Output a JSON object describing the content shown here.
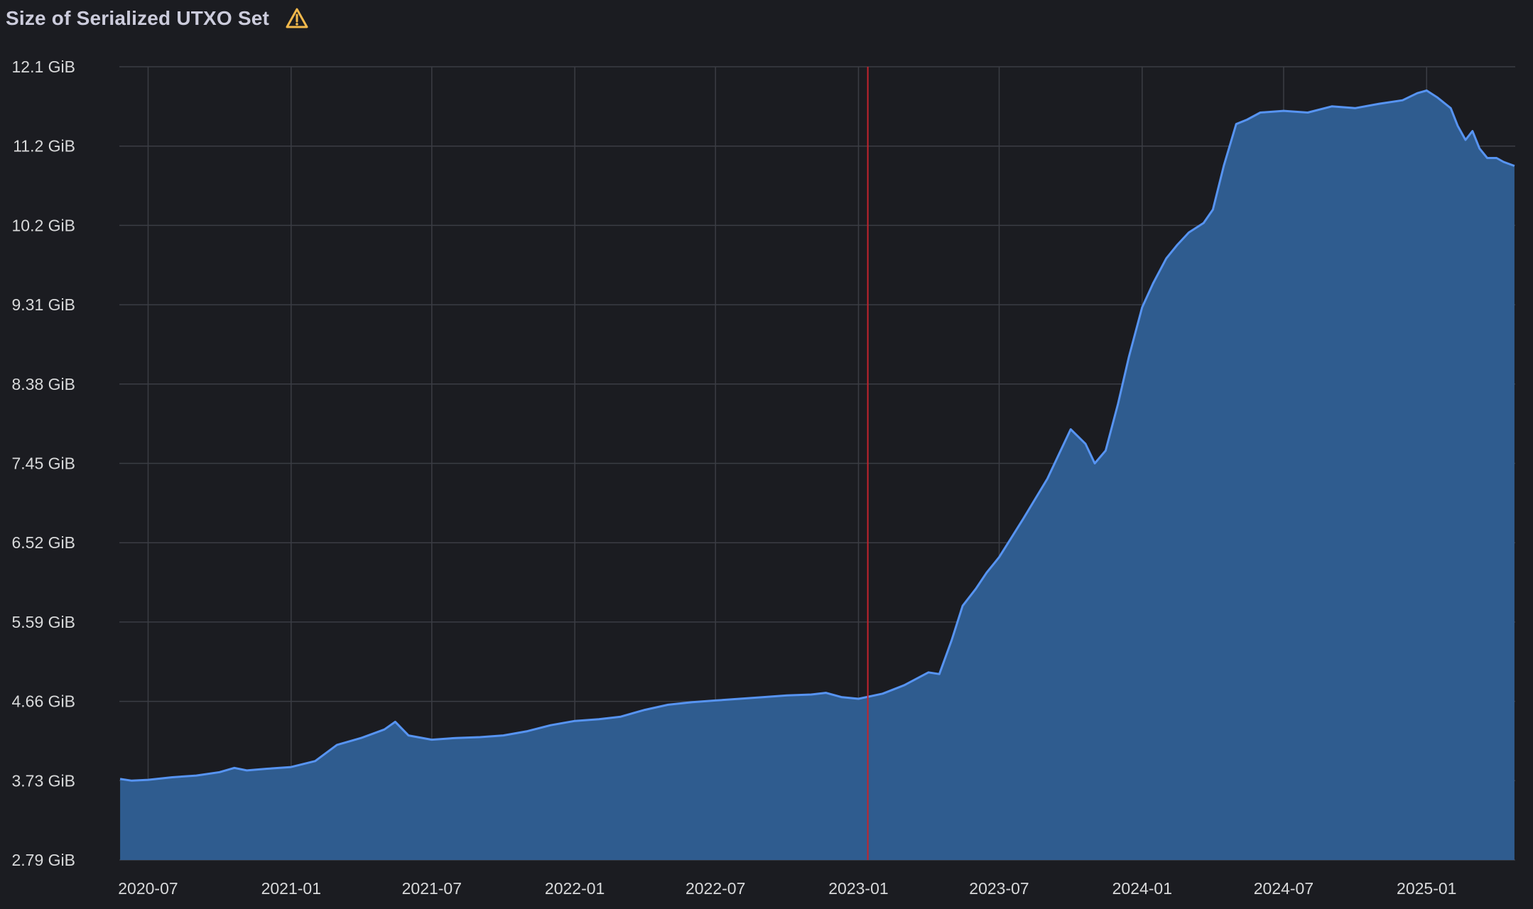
{
  "panel": {
    "title": "Size of Serialized UTXO Set",
    "warning_icon": "warning-triangle-icon"
  },
  "colors": {
    "background": "#1b1c21",
    "grid": "#3b3d44",
    "series_line": "#5794f2",
    "series_fill": "#2f5c8f",
    "annotation_line": "#c4242d",
    "warning": "#f2b84b"
  },
  "chart_data": {
    "type": "area",
    "title": "Size of Serialized UTXO Set",
    "xlabel": "",
    "ylabel": "",
    "y_unit": "GiB",
    "ylim": [
      2.79,
      12.1
    ],
    "xlim": [
      "2020-05-25",
      "2025-04-25"
    ],
    "grid": true,
    "y_ticks": [
      2.79,
      3.73,
      4.66,
      5.59,
      6.52,
      7.45,
      8.38,
      9.31,
      10.2,
      11.2,
      12.1
    ],
    "y_tick_labels": [
      "2.79 GiB",
      "3.73 GiB",
      "4.66 GiB",
      "5.59 GiB",
      "6.52 GiB",
      "7.45 GiB",
      "8.38 GiB",
      "9.31 GiB",
      "10.2 GiB",
      "11.2 GiB",
      "12.1 GiB"
    ],
    "x_ticks": [
      "2020-07-01",
      "2021-01-01",
      "2021-07-01",
      "2022-01-01",
      "2022-07-01",
      "2023-01-01",
      "2023-07-01",
      "2024-01-01",
      "2024-07-01",
      "2025-01-01"
    ],
    "x_tick_labels": [
      "2020-07",
      "2021-01",
      "2021-07",
      "2022-01",
      "2022-07",
      "2023-01",
      "2023-07",
      "2024-01",
      "2024-07",
      "2025-01"
    ],
    "annotations": [
      {
        "type": "vertical-line",
        "x": "2023-01-13"
      }
    ],
    "series": [
      {
        "x": [
          "2020-05-26",
          "2020-06-10",
          "2020-07-01",
          "2020-08-01",
          "2020-09-01",
          "2020-10-01",
          "2020-10-20",
          "2020-11-05",
          "2020-12-01",
          "2021-01-01",
          "2021-02-01",
          "2021-03-01",
          "2021-04-01",
          "2021-05-01",
          "2021-05-15",
          "2021-06-01",
          "2021-07-01",
          "2021-08-01",
          "2021-09-01",
          "2021-10-01",
          "2021-11-01",
          "2021-12-01",
          "2022-01-01",
          "2022-02-01",
          "2022-03-01",
          "2022-04-01",
          "2022-05-01",
          "2022-06-01",
          "2022-07-01",
          "2022-08-01",
          "2022-09-01",
          "2022-10-01",
          "2022-11-01",
          "2022-11-20",
          "2022-12-10",
          "2023-01-01",
          "2023-02-01",
          "2023-03-01",
          "2023-04-01",
          "2023-04-15",
          "2023-05-01",
          "2023-05-15",
          "2023-06-01",
          "2023-06-15",
          "2023-07-01",
          "2023-08-01",
          "2023-09-01",
          "2023-10-01",
          "2023-10-20",
          "2023-11-01",
          "2023-11-15",
          "2023-12-01",
          "2023-12-15",
          "2024-01-01",
          "2024-01-15",
          "2024-02-01",
          "2024-02-15",
          "2024-03-01",
          "2024-03-20",
          "2024-04-01",
          "2024-04-15",
          "2024-05-01",
          "2024-05-15",
          "2024-06-01",
          "2024-07-01",
          "2024-08-01",
          "2024-09-01",
          "2024-10-01",
          "2024-11-01",
          "2024-12-01",
          "2024-12-20",
          "2025-01-01",
          "2025-01-15",
          "2025-02-01",
          "2025-02-10",
          "2025-02-20",
          "2025-03-01",
          "2025-03-10",
          "2025-03-20",
          "2025-04-01",
          "2025-04-10",
          "2025-04-24"
        ],
        "values": [
          3.75,
          3.73,
          3.74,
          3.77,
          3.79,
          3.83,
          3.88,
          3.85,
          3.87,
          3.89,
          3.96,
          4.15,
          4.23,
          4.33,
          4.42,
          4.26,
          4.21,
          4.23,
          4.24,
          4.26,
          4.31,
          4.38,
          4.43,
          4.45,
          4.48,
          4.56,
          4.62,
          4.65,
          4.67,
          4.69,
          4.71,
          4.73,
          4.74,
          4.76,
          4.71,
          4.69,
          4.75,
          4.85,
          5.0,
          4.98,
          5.38,
          5.78,
          5.98,
          6.17,
          6.35,
          6.8,
          7.27,
          7.85,
          7.68,
          7.45,
          7.6,
          8.15,
          8.7,
          9.28,
          9.55,
          9.83,
          9.98,
          10.12,
          10.23,
          10.4,
          10.95,
          11.45,
          11.5,
          11.58,
          11.6,
          11.58,
          11.65,
          11.63,
          11.68,
          11.72,
          11.8,
          11.83,
          11.75,
          11.63,
          11.43,
          11.27,
          11.37,
          11.17,
          11.05,
          11.05,
          11.0,
          10.95
        ]
      }
    ]
  }
}
